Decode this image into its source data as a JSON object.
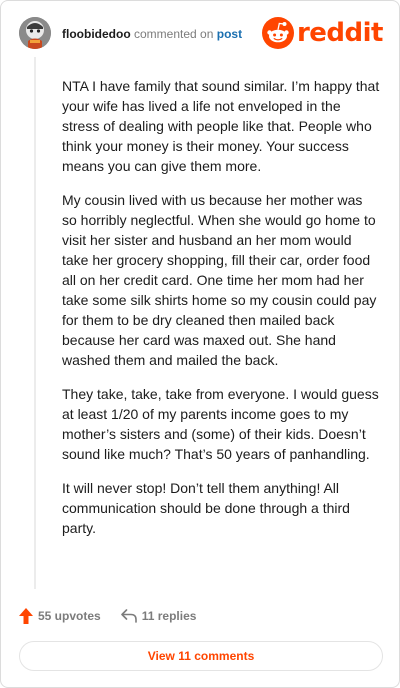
{
  "header": {
    "username": "floobidedoo",
    "action_text": "commented on",
    "post_link": "post",
    "brand": "reddit"
  },
  "comment": {
    "paragraphs": [
      "NTA I have family that sound similar. I’m happy that your wife has lived a life not enveloped in the stress of dealing with people like that. People who think your money is their money. Your success means you can give them more.",
      "My cousin lived with us because her mother was so horribly neglectful. When she would go home to visit her sister and husband an her mom would take her grocery shopping, fill their car, order food all on her credit card. One time her mom had her take some silk shirts home so my cousin could pay for them to be dry cleaned then mailed back because her card was maxed out. She hand washed them and mailed the back.",
      "They take, take, take from everyone. I would guess at least 1/20 of my parents income goes to my mother’s sisters and (some) of their kids. Doesn’t sound like much? That’s 50 years of panhandling.",
      "It will never stop! Don’t tell them anything! All communication should be done through a third party."
    ]
  },
  "footer": {
    "upvotes": "55 upvotes",
    "replies": "11 replies",
    "view_comments": "View 11 comments"
  },
  "colors": {
    "accent": "#ff4500",
    "link": "#1a6fb0",
    "muted": "#7c7c7c"
  },
  "icons": {
    "upvote": "upvote-arrow-icon",
    "reply": "reply-arrow-icon",
    "brand": "reddit-alien-icon"
  }
}
